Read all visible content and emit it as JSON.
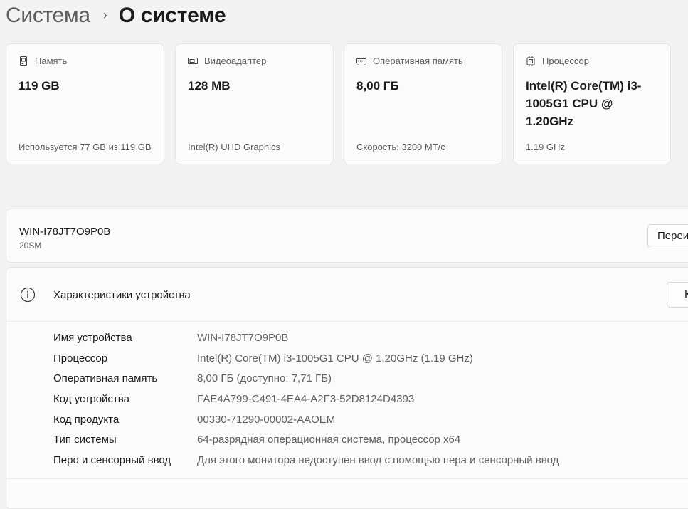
{
  "breadcrumb": {
    "parent": "Система",
    "separator": "›",
    "current": "О системе"
  },
  "cards": [
    {
      "icon": "storage-icon",
      "title": "Память",
      "value": "119 GB",
      "sub": "Используется 77 GB из 119 GB"
    },
    {
      "icon": "display-adapter-icon",
      "title": "Видеоадаптер",
      "value": "128 MB",
      "sub": "Intel(R) UHD Graphics"
    },
    {
      "icon": "ram-icon",
      "title": "Оперативная память",
      "value": "8,00 ГБ",
      "sub": "Скорость: 3200 MT/c"
    },
    {
      "icon": "processor-icon",
      "title": "Процессор",
      "value": "Intel(R) Core(TM) i3-1005G1 CPU @ 1.20GHz",
      "sub": "1.19 GHz"
    }
  ],
  "pc": {
    "name": "WIN-I78JT7O9P0B",
    "model": "20SM",
    "rename_label": "Переи"
  },
  "specs": {
    "title": "Характеристики устройства",
    "copy_label": "К",
    "rows": [
      {
        "label": "Имя устройства",
        "value": "WIN-I78JT7O9P0B"
      },
      {
        "label": "Процессор",
        "value": "Intel(R) Core(TM) i3-1005G1 CPU @ 1.20GHz (1.19 GHz)"
      },
      {
        "label": "Оперативная память",
        "value": "8,00 ГБ (доступно: 7,71 ГБ)"
      },
      {
        "label": "Код устройства",
        "value": "FAE4A799-C491-4EA4-A2F3-52D8124D4393"
      },
      {
        "label": "Код продукта",
        "value": "00330-71290-00002-AAOEM"
      },
      {
        "label": "Тип системы",
        "value": "64-разрядная операционная система, процессор x64"
      },
      {
        "label": "Перо и сенсорный ввод",
        "value": "Для этого монитора недоступен ввод с помощью пера и сенсорный ввод"
      }
    ]
  }
}
